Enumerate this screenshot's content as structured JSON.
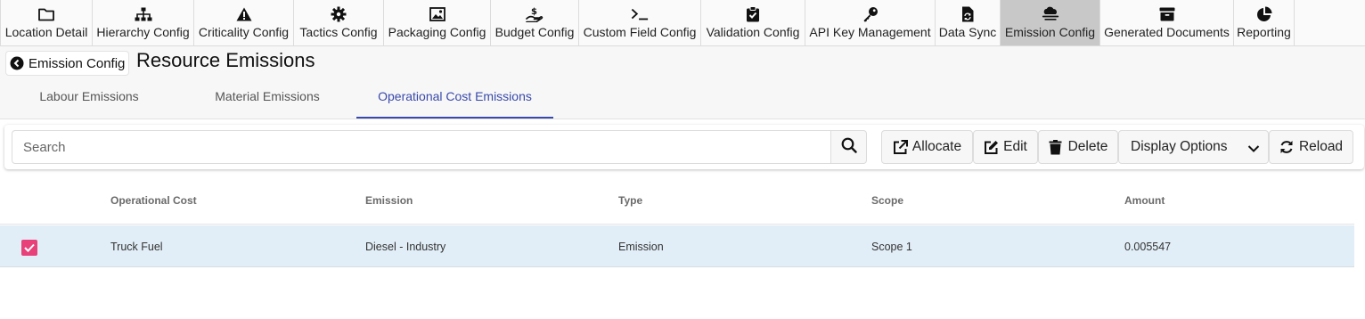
{
  "nav": {
    "items": [
      {
        "label": "Location Detail",
        "icon": "folder-icon"
      },
      {
        "label": "Hierarchy Config",
        "icon": "sitemap-icon"
      },
      {
        "label": "Criticality Config",
        "icon": "warning-icon"
      },
      {
        "label": "Tactics Config",
        "icon": "gear-icon"
      },
      {
        "label": "Packaging Config",
        "icon": "image-icon"
      },
      {
        "label": "Budget Config",
        "icon": "hand-dollar-icon"
      },
      {
        "label": "Custom Field Config",
        "icon": "terminal-icon"
      },
      {
        "label": "Validation Config",
        "icon": "clipboard-check-icon"
      },
      {
        "label": "API Key Management",
        "icon": "key-icon"
      },
      {
        "label": "Data Sync",
        "icon": "file-sync-icon"
      },
      {
        "label": "Emission Config",
        "icon": "cloud-smog-icon"
      },
      {
        "label": "Generated Documents",
        "icon": "archive-icon"
      },
      {
        "label": "Reporting",
        "icon": "pie-chart-icon"
      }
    ],
    "active": "Emission Config"
  },
  "header": {
    "back_label": "Emission Config",
    "title": "Resource Emissions"
  },
  "tabs": [
    {
      "label": "Labour Emissions"
    },
    {
      "label": "Material Emissions"
    },
    {
      "label": "Operational Cost Emissions"
    }
  ],
  "active_tab": "Operational Cost Emissions",
  "toolbar": {
    "search_placeholder": "Search",
    "allocate_label": "Allocate",
    "edit_label": "Edit",
    "delete_label": "Delete",
    "display_options_label": "Display Options",
    "reload_label": "Reload"
  },
  "table": {
    "columns": [
      "Operational Cost",
      "Emission",
      "Type",
      "Scope",
      "Amount"
    ],
    "rows": [
      {
        "checked": true,
        "cells": [
          "Truck Fuel",
          "Diesel - Industry",
          "Emission",
          "Scope 1",
          "0.005547"
        ]
      }
    ]
  },
  "colors": {
    "accent": "#3949ab",
    "checkbox": "#e8417a",
    "selected_row": "#e2eef7",
    "active_nav": "#c8c8c8"
  }
}
